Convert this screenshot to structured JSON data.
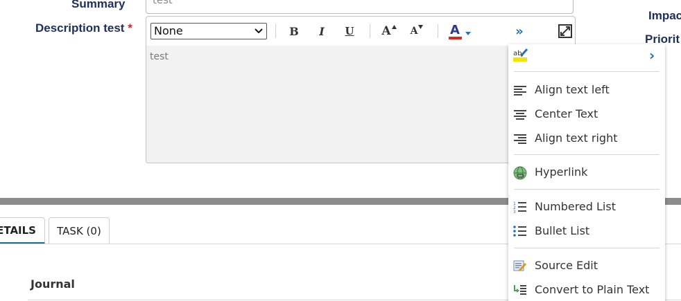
{
  "form": {
    "summary_label": "Summary",
    "summary_value": "test",
    "description_label": "Description test",
    "required_mark": "*"
  },
  "right_labels": {
    "impact": "Impac",
    "priority": "Priorit"
  },
  "editor": {
    "font_select_value": "None",
    "content": "test",
    "toolbar": {
      "bold": "B",
      "italic": "I",
      "underline": "U",
      "grow_font": "A",
      "shrink_font": "A",
      "font_color": "A",
      "more": "»",
      "font_color_accent": "#e0261b",
      "link_blue": "#2a6fb0"
    }
  },
  "tabs": {
    "details": "ETAILS",
    "task": "TASK (0)"
  },
  "section": {
    "journal": "Journal"
  },
  "menu": {
    "highlight_submenu_arrow": "›",
    "items": [
      {
        "label": "Align text left",
        "icon": "align-left-icon"
      },
      {
        "label": "Center Text",
        "icon": "align-center-icon"
      },
      {
        "label": "Align text right",
        "icon": "align-right-icon"
      },
      {
        "label": "Hyperlink",
        "icon": "hyperlink-icon"
      },
      {
        "label": "Numbered List",
        "icon": "numbered-list-icon"
      },
      {
        "label": "Bullet List",
        "icon": "bullet-list-icon"
      },
      {
        "label": "Source Edit",
        "icon": "source-edit-icon"
      },
      {
        "label": "Convert to Plain Text",
        "icon": "plain-text-icon"
      }
    ]
  }
}
